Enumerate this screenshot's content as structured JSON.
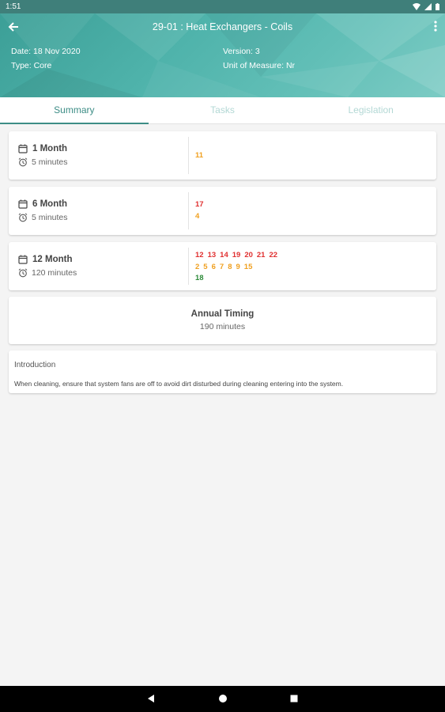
{
  "status_bar": {
    "time": "1:51"
  },
  "header": {
    "title": "29-01 : Heat Exchangers - Coils",
    "date": "Date: 18 Nov 2020",
    "type": "Type: Core",
    "version": "Version: 3",
    "unit": "Unit of Measure: Nr"
  },
  "tabs": [
    {
      "label": "Summary",
      "active": true
    },
    {
      "label": "Tasks",
      "active": false
    },
    {
      "label": "Legislation",
      "active": false
    }
  ],
  "frequencies": [
    {
      "label": "1 Month",
      "time": "5 minutes",
      "task_groups": [
        {
          "color": "orange",
          "ids": [
            "11"
          ]
        }
      ]
    },
    {
      "label": "6 Month",
      "time": "5 minutes",
      "task_groups": [
        {
          "color": "red",
          "ids": [
            "17"
          ]
        },
        {
          "color": "orange",
          "ids": [
            "4"
          ]
        }
      ]
    },
    {
      "label": "12 Month",
      "time": "120 minutes",
      "task_groups": [
        {
          "color": "red",
          "ids": [
            "12",
            "13",
            "14",
            "19",
            "20",
            "21",
            "22"
          ]
        },
        {
          "color": "orange",
          "ids": [
            "2",
            "5",
            "6",
            "7",
            "8",
            "9",
            "15"
          ]
        },
        {
          "color": "green",
          "ids": [
            "18"
          ]
        }
      ]
    }
  ],
  "annual": {
    "title": "Annual Timing",
    "value": "190 minutes"
  },
  "introduction": {
    "title": "Introduction",
    "text": "When cleaning, ensure that system fans are off to avoid dirt disturbed during cleaning entering into the system."
  },
  "colors": {
    "accent": "#3d8d86",
    "red": "#e03131",
    "orange": "#f0a020",
    "green": "#2e8b3a"
  },
  "icons": [
    "back-arrow-icon",
    "more-vert-icon",
    "calendar-icon",
    "alarm-clock-icon",
    "wifi-icon",
    "signal-icon",
    "battery-icon",
    "nav-back-icon",
    "nav-home-icon",
    "nav-recents-icon"
  ]
}
